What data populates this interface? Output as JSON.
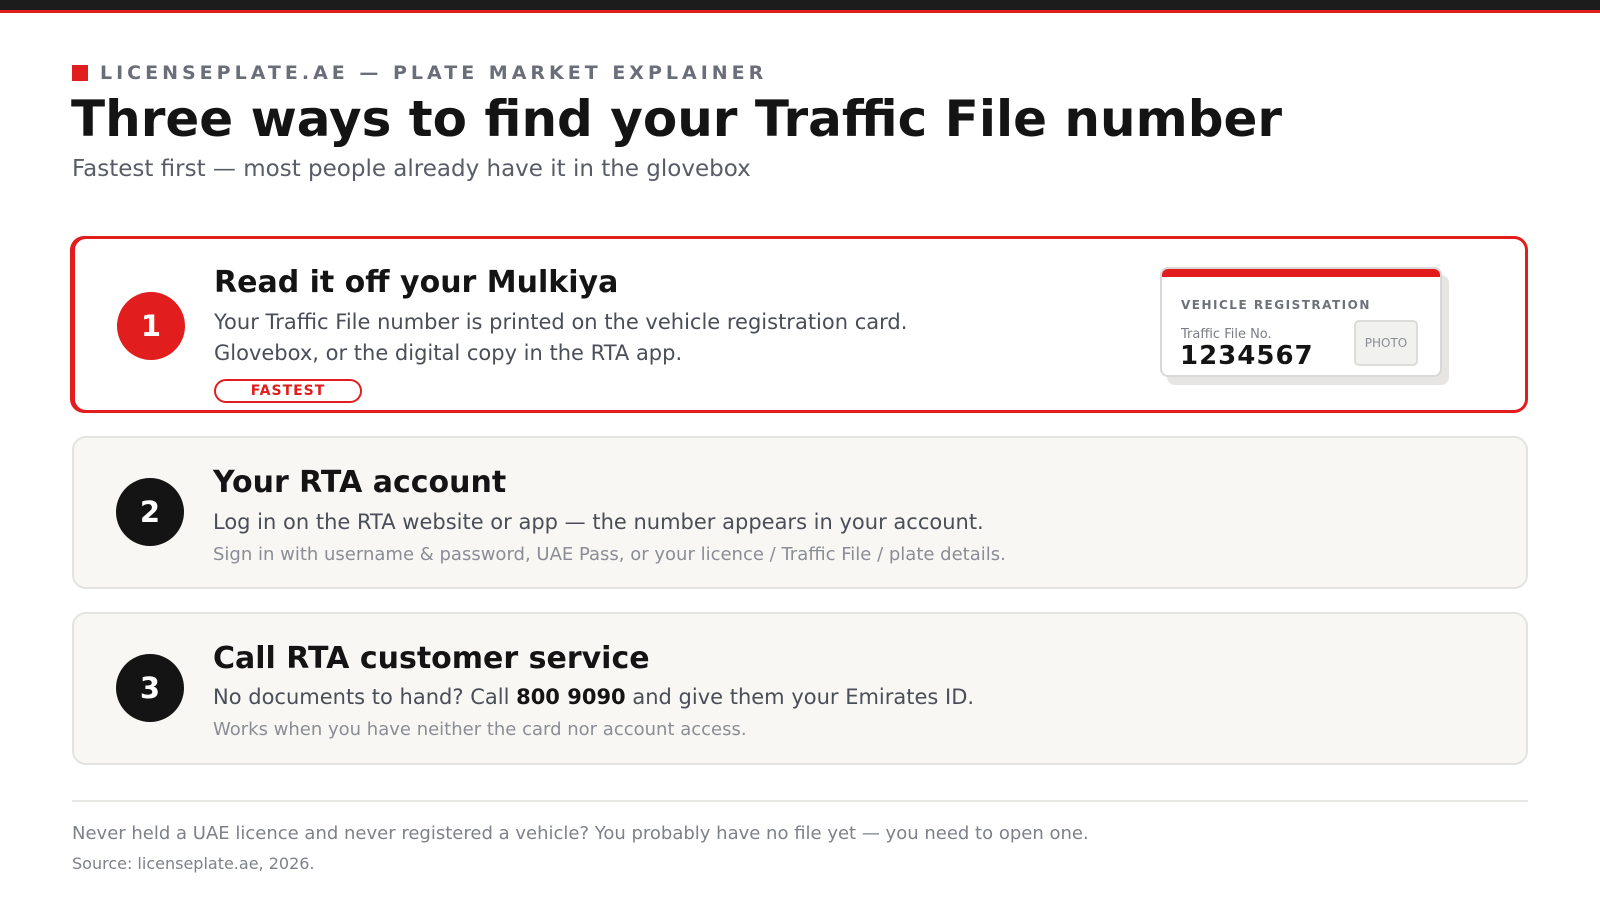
{
  "header": {
    "kicker": "LICENSEPLATE.AE — PLATE MARKET EXPLAINER",
    "title": "Three ways to find your Traffic File number",
    "subtitle": "Fastest first — most people already have it in the glovebox"
  },
  "steps": [
    {
      "number": "1",
      "title": "Read it off your Mulkiya",
      "line1": "Your Traffic File number is printed on the vehicle registration card.",
      "line2": "Glovebox, or the digital copy in the RTA app.",
      "badge": "FASTEST",
      "card": {
        "heading": "VEHICLE REGISTRATION",
        "label": "Traffic File No.",
        "number": "1234567",
        "photo": "PHOTO"
      }
    },
    {
      "number": "2",
      "title": "Your RTA account",
      "line1": "Log in on the RTA website or app — the number appears in your account.",
      "note": "Sign in with username & password, UAE Pass, or your licence / Traffic File / plate details."
    },
    {
      "number": "3",
      "title": "Call RTA customer service",
      "line1_pre": "No documents to hand? Call ",
      "line1_phone": "800 9090",
      "line1_post": " and give them your Emirates ID.",
      "note": "Works when you have neither the card nor account access."
    }
  ],
  "footer": {
    "note": "Never held a UAE licence and never registered a vehicle? You probably have no file yet — you need to open one.",
    "source": "Source: licenseplate.ae, 2026."
  },
  "colors": {
    "accent": "#e11d1d",
    "dark": "#141414",
    "muted_card_bg": "#f8f7f4"
  }
}
